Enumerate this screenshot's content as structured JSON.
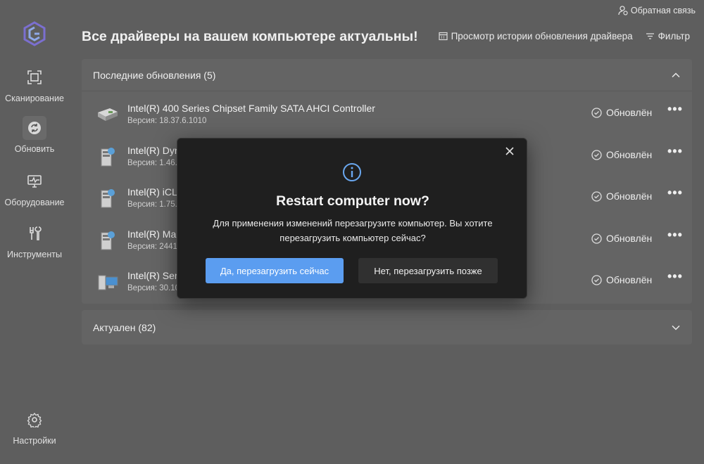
{
  "feedback_label": "Обратная связь",
  "page_title": "Все драйверы на вашем компьютере актуальны!",
  "toolbar": {
    "history_label": "Просмотр истории обновления драйвера",
    "filter_label": "Фильтр"
  },
  "sidebar": {
    "items": [
      {
        "label": "Сканирование",
        "icon": "scan-icon"
      },
      {
        "label": "Обновить",
        "icon": "refresh-icon",
        "active": true
      },
      {
        "label": "Оборудование",
        "icon": "hardware-monitor-icon"
      },
      {
        "label": "Инструменты",
        "icon": "tools-icon"
      }
    ],
    "settings_label": "Настройки"
  },
  "recent": {
    "header": "Последние обновления (5)",
    "rows": [
      {
        "name": "Intel(R) 400 Series Chipset Family SATA AHCI Controller",
        "version": "Версия: 18.37.6.1010",
        "status": "Обновлён",
        "icon": "disk-controller-icon"
      },
      {
        "name": "Intel(R) Dyn",
        "version": "Версия: 1.46.",
        "status": "Обновлён",
        "icon": "system-device-icon"
      },
      {
        "name": "Intel(R) iCLS",
        "version": "Версия: 1.75.",
        "status": "Обновлён",
        "icon": "system-device-icon"
      },
      {
        "name": "Intel(R) Ma",
        "version": "Версия: 2441",
        "status": "Обновлён",
        "icon": "system-device-icon"
      },
      {
        "name": "Intel(R) Seri",
        "version": "Версия: 30.10",
        "status": "Обновлён",
        "icon": "computer-device-icon"
      }
    ]
  },
  "actual": {
    "header": "Актуален (82)"
  },
  "modal": {
    "title": "Restart computer now?",
    "message": "Для применения изменений перезагрузите компьютер. Вы хотите перезагрузить компьютер сейчас?",
    "yes_label": "Да, перезагрузить сейчас",
    "no_label": "Нет, перезагрузить позже",
    "accent": "#5b9df0"
  }
}
